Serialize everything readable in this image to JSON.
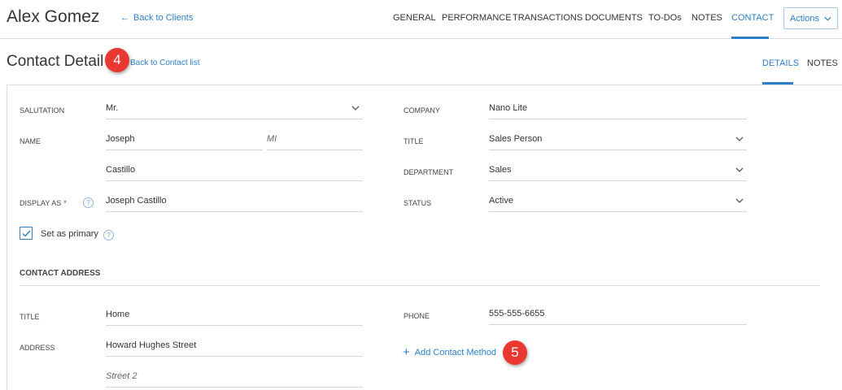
{
  "header": {
    "client_name": "Alex Gomez",
    "back_to_clients": "Back to Clients",
    "nav": [
      "GENERAL",
      "PERFORMANCE",
      "TRANSACTIONS",
      "DOCUMENTS",
      "TO-DOs",
      "NOTES",
      "CONTACT"
    ],
    "active_nav": "CONTACT",
    "actions_label": "Actions"
  },
  "subheader": {
    "title": "Contact Detail",
    "back_to_list": "Back to Contact list",
    "tabs": [
      "DETAILS",
      "NOTES"
    ],
    "active_tab": "DETAILS"
  },
  "callouts": {
    "badge_4": "4",
    "badge_5": "5",
    "color": "#e8382f"
  },
  "form": {
    "salutation": {
      "label": "SALUTATION",
      "value": "Mr."
    },
    "name": {
      "label": "NAME",
      "first": "Joseph",
      "mi_placeholder": "MI",
      "last": "Castillo"
    },
    "display_as": {
      "label": "DISPLAY AS",
      "required_mark": "*",
      "value": "Joseph Castillo"
    },
    "company": {
      "label": "COMPANY",
      "value": "Nano Lite"
    },
    "title": {
      "label": "TITLE",
      "value": "Sales Person"
    },
    "department": {
      "label": "DEPARTMENT",
      "value": "Sales"
    },
    "status": {
      "label": "STATUS",
      "value": "Active"
    },
    "primary": {
      "label": "Set as primary",
      "checked": true
    },
    "help_glyph": "?"
  },
  "address": {
    "section_title": "CONTACT ADDRESS",
    "title": {
      "label": "TITLE",
      "value": "Home"
    },
    "address": {
      "label": "ADDRESS",
      "street1": "Howard Hughes Street",
      "street2_placeholder": "Street 2"
    },
    "phone": {
      "label": "PHONE",
      "value": "555-555-6655"
    },
    "add_method": "Add Contact Method"
  },
  "colors": {
    "accent": "#2c7fc9",
    "border": "#dcdcdc"
  }
}
